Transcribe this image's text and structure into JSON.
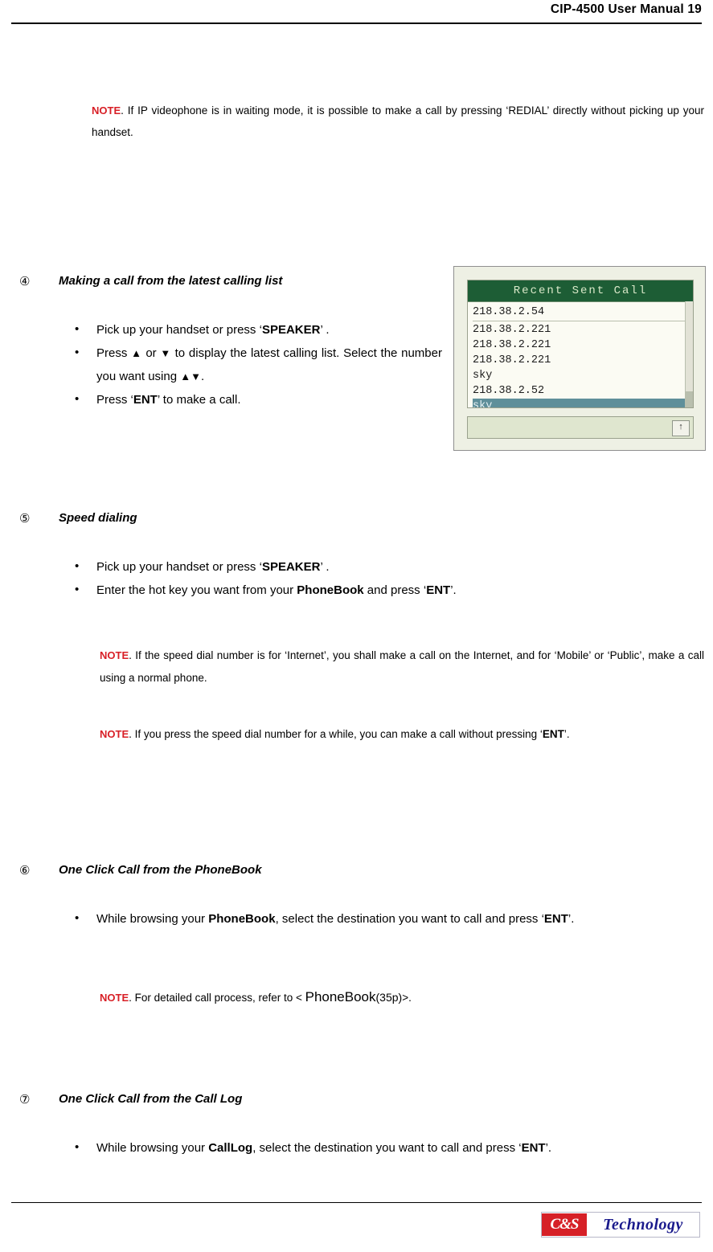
{
  "header": {
    "title": "CIP-4500 User Manual  19"
  },
  "footer": {
    "logo_mark": "C&S",
    "logo_text": "Technology"
  },
  "notes": {
    "redial": {
      "label": "NOTE",
      "text": ". If IP videophone is in waiting mode, it is possible to make a call by pressing ‘REDIAL’ directly without picking up your handset."
    },
    "internet": {
      "label": "NOTE",
      "text": ". If the speed dial number is for ‘Internet’, you shall make a call on the Internet, and for ‘Mobile’ or ‘Public’, make a call using a normal phone."
    },
    "speeddial_hold": {
      "label": "NOTE",
      "text_before": ". If you press the speed dial number for a while, you can make a call without pressing ‘",
      "bold": "ENT",
      "text_after": "’."
    },
    "phonebook_ref": {
      "label": "NOTE",
      "text_before": ". For detailed call process, refer to < ",
      "link": "PhoneBook",
      "link_suffix": "(35p)",
      "text_after": ">."
    }
  },
  "sections": [
    {
      "number": "④",
      "title": "Making a call from the latest calling list",
      "bullets": [
        {
          "parts": [
            {
              "t": "Pick up your handset or press ‘",
              "b": false
            },
            {
              "t": "SPEAKER",
              "b": true
            },
            {
              "t": "’ .",
              "b": false
            }
          ]
        },
        {
          "parts": [
            {
              "t": "Press ",
              "b": false
            },
            {
              "t": "▲",
              "b": false
            },
            {
              "t": " or ",
              "b": false
            },
            {
              "t": "▼",
              "b": false
            },
            {
              "t": " to display the latest calling list. Select the number you want using ",
              "b": false
            },
            {
              "t": "▲▼",
              "b": false
            },
            {
              "t": ".",
              "b": false
            }
          ]
        },
        {
          "parts": [
            {
              "t": "Press ‘",
              "b": false
            },
            {
              "t": "ENT",
              "b": true
            },
            {
              "t": "’ to make a call.",
              "b": false
            }
          ]
        }
      ]
    },
    {
      "number": "⑤",
      "title": "Speed dialing",
      "bullets": [
        {
          "parts": [
            {
              "t": "Pick up your handset or press ‘",
              "b": false
            },
            {
              "t": "SPEAKER",
              "b": true
            },
            {
              "t": "’ .",
              "b": false
            }
          ]
        },
        {
          "parts": [
            {
              "t": "Enter the hot key you want from your ",
              "b": false
            },
            {
              "t": "PhoneBook",
              "b": true
            },
            {
              "t": " and press ‘",
              "b": false
            },
            {
              "t": "ENT",
              "b": true
            },
            {
              "t": "’.",
              "b": false
            }
          ]
        }
      ]
    },
    {
      "number": "⑥",
      "title": "One Click Call from the PhoneBook",
      "bullets": [
        {
          "parts": [
            {
              "t": "While browsing your ",
              "b": false
            },
            {
              "t": "PhoneBook",
              "b": true
            },
            {
              "t": ", select the destination you want to call and press ‘",
              "b": false
            },
            {
              "t": "ENT",
              "b": true
            },
            {
              "t": "’.",
              "b": false
            }
          ]
        }
      ]
    },
    {
      "number": "⑦",
      "title": "One Click Call from the Call Log",
      "bullets": [
        {
          "parts": [
            {
              "t": "While browsing your ",
              "b": false
            },
            {
              "t": "CallLog",
              "b": true
            },
            {
              "t": ", select the destination you want to call and press ‘",
              "b": false
            },
            {
              "t": "ENT",
              "b": true
            },
            {
              "t": "’.",
              "b": false
            }
          ]
        }
      ]
    }
  ],
  "device_screenshot": {
    "lcd_title": "Recent Sent Call",
    "lcd_rows": [
      {
        "text": "218.38.2.54",
        "selected": false,
        "separator": true
      },
      {
        "text": "218.38.2.221",
        "selected": false,
        "separator": false
      },
      {
        "text": "218.38.2.221",
        "selected": false,
        "separator": false
      },
      {
        "text": "218.38.2.221",
        "selected": false,
        "separator": false
      },
      {
        "text": "sky",
        "selected": false,
        "separator": false
      },
      {
        "text": "218.38.2.52",
        "selected": false,
        "separator": false
      },
      {
        "text": "sky",
        "selected": true,
        "separator": false
      }
    ],
    "button_label": "↑"
  }
}
